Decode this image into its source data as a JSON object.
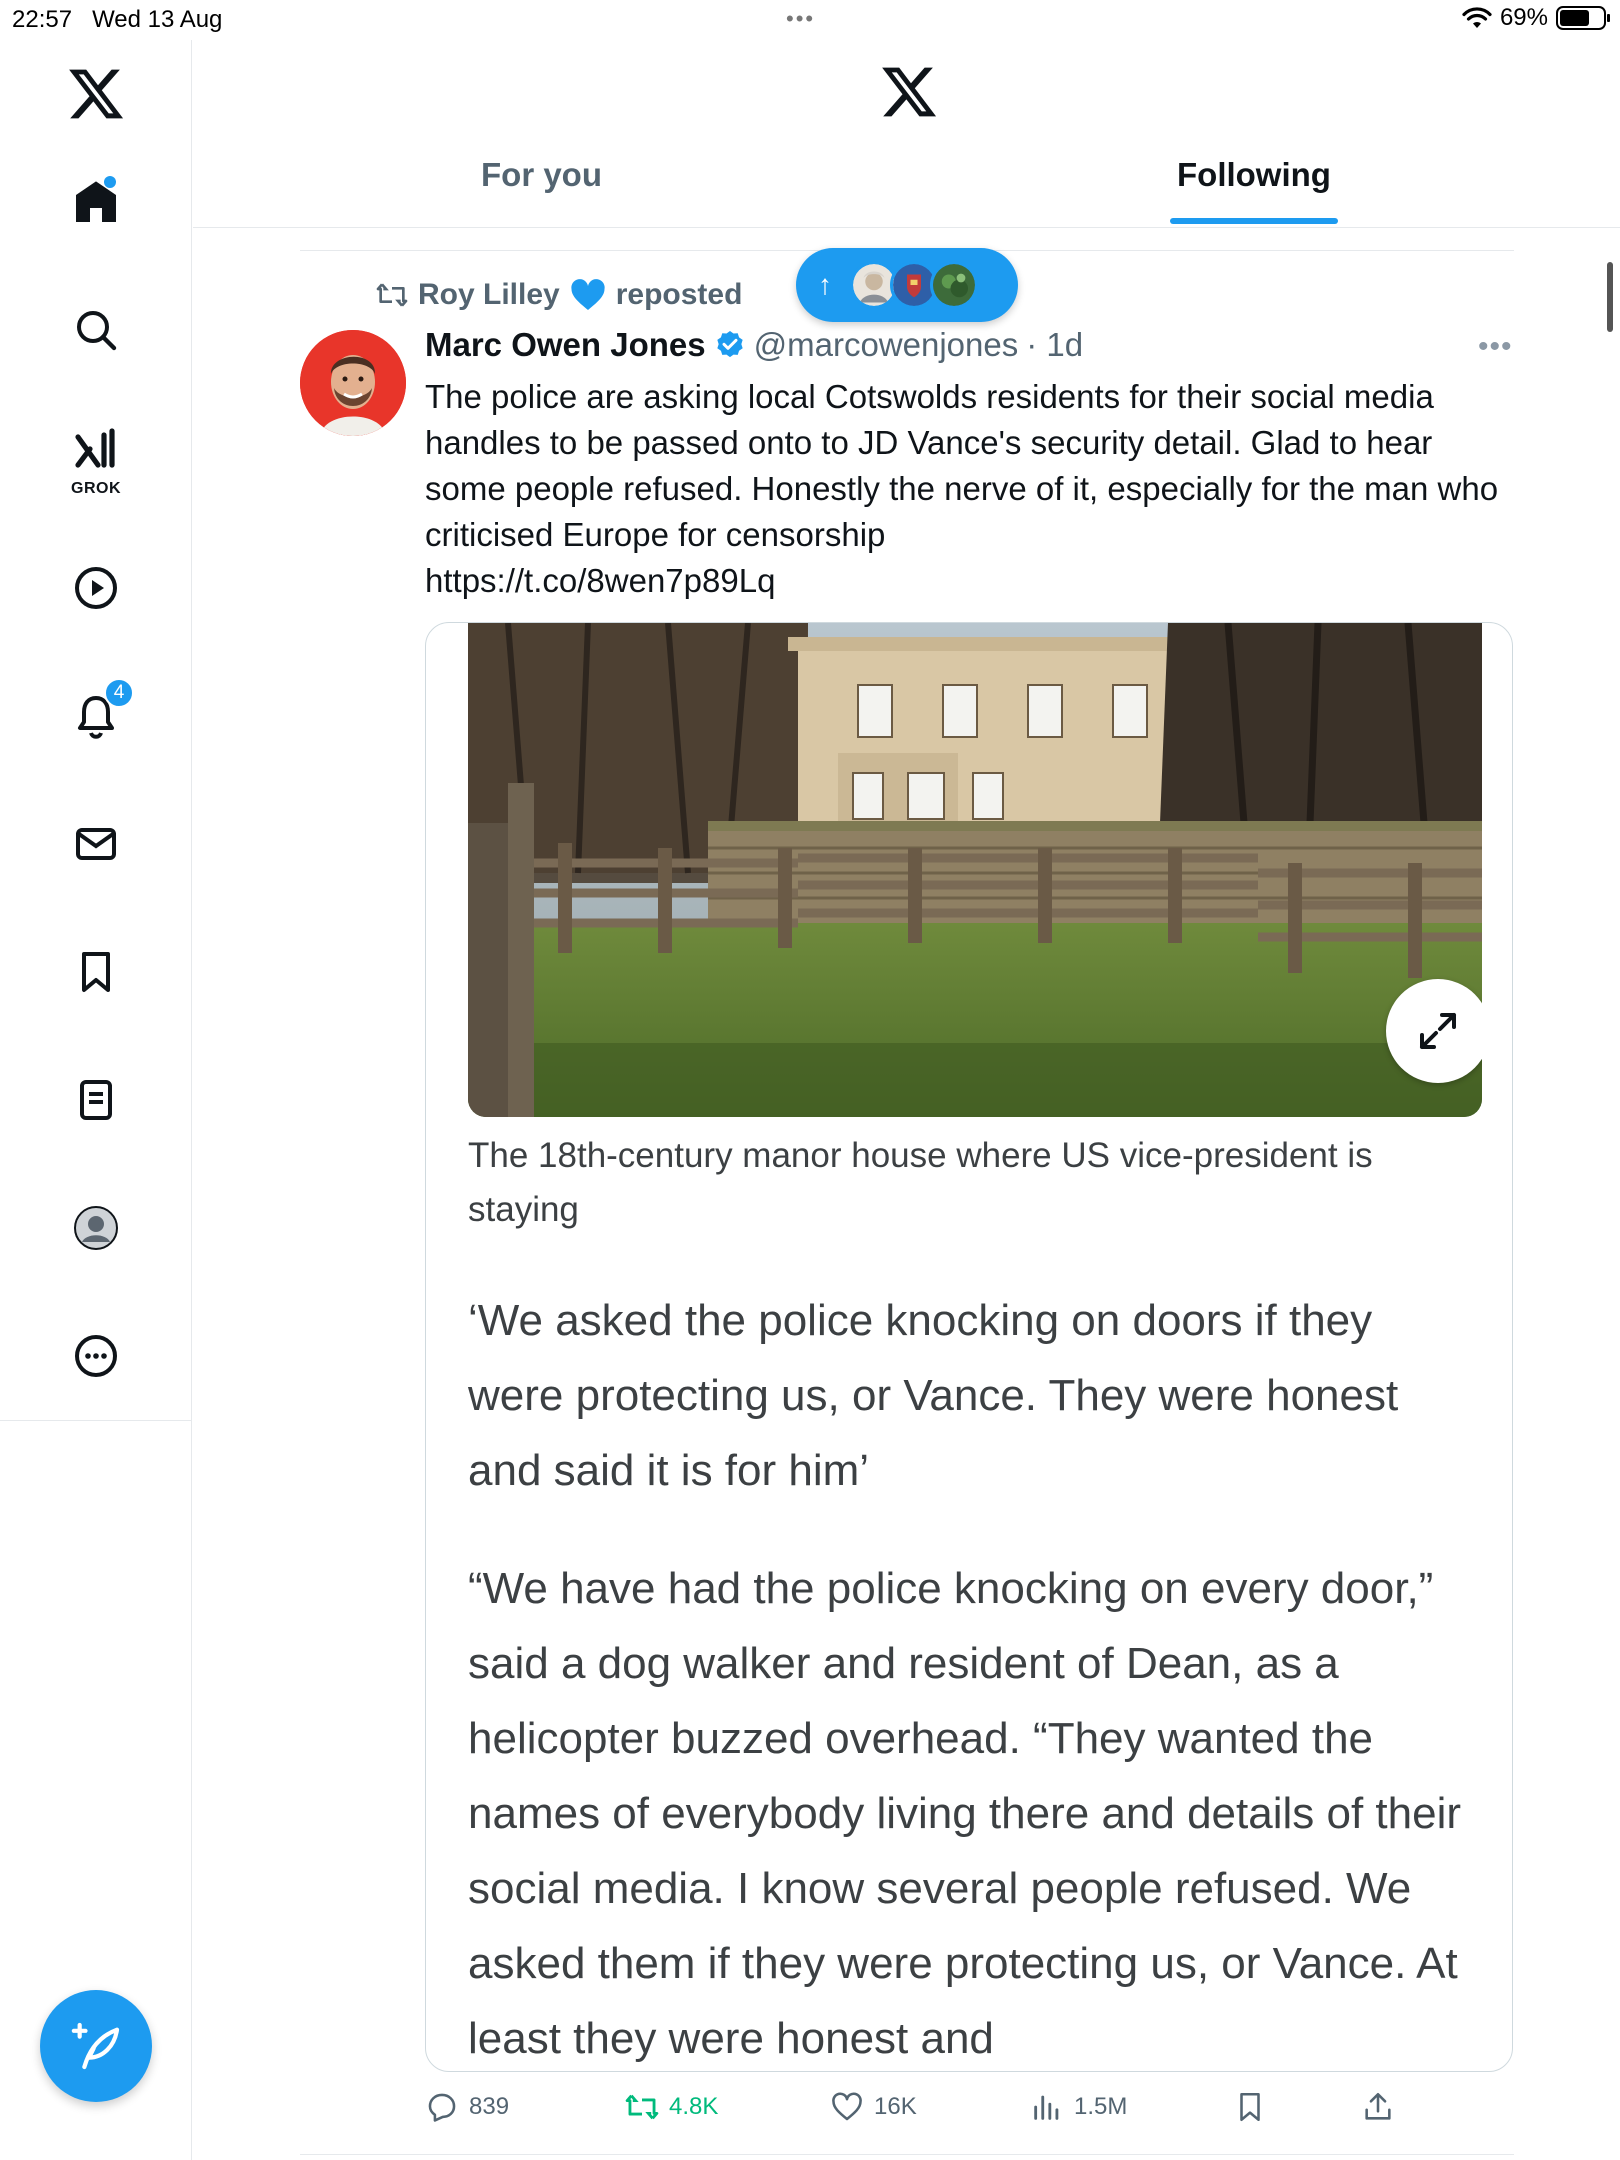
{
  "status_bar": {
    "time": "22:57",
    "date": "Wed 13 Aug",
    "dots": "•••",
    "battery_percent": "69%",
    "battery_level": 0.69
  },
  "sidebar": {
    "items": [
      {
        "name": "home",
        "active": true
      },
      {
        "name": "search"
      },
      {
        "name": "grok",
        "label": "GROK"
      },
      {
        "name": "video"
      },
      {
        "name": "notifications",
        "badge": "4"
      },
      {
        "name": "messages"
      },
      {
        "name": "bookmarks"
      },
      {
        "name": "lists"
      },
      {
        "name": "profile"
      },
      {
        "name": "more"
      }
    ]
  },
  "header": {
    "tabs": [
      {
        "label": "For you",
        "active": false
      },
      {
        "label": "Following",
        "active": true
      }
    ]
  },
  "accent_color": "#1d9bf0",
  "tweet": {
    "repost_by": "Roy Lilley",
    "repost_suffix": "reposted",
    "author": {
      "name": "Marc Owen Jones",
      "handle": "@marcowenjones",
      "time": "· 1d",
      "verified": true
    },
    "text": "The police are asking local Cotswolds residents for their social media handles to be passed onto to JD Vance's security detail. Glad to hear some people refused. Honestly the nerve of it, especially for the man who criticised Europe for censorship",
    "link": "https://t.co/8wen7p89Lq",
    "card": {
      "caption": "The 18th-century manor house where US vice-president is staying",
      "paragraph1": "‘We asked the police knocking on doors if they were protecting us, or Vance. They were honest and said it is for him’",
      "paragraph2": "“We have had the police knocking on every door,” said a dog walker and resident of Dean, as a helicopter buzzed overhead. “They wanted the names of everybody living there and details of their social media. I know several people refused. We asked them if they were protecting us, or Vance. At least they were honest and"
    },
    "stats": {
      "replies": "839",
      "reposts": "4.8K",
      "likes": "16K",
      "views": "1.5M"
    }
  }
}
